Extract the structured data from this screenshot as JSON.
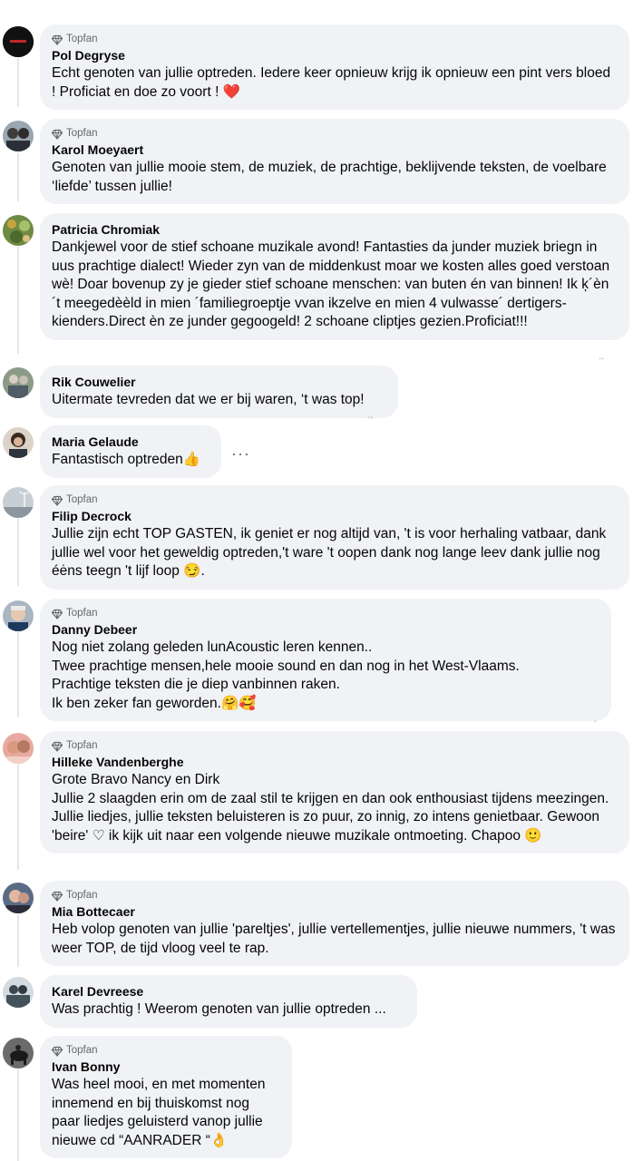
{
  "badge_label": "Topfan",
  "comments": [
    {
      "name": "Pol Degryse",
      "topfan": true,
      "text": "Echt genoten van jullie optreden. Iedere keer opnieuw krijg ik opnieuw een pint vers bloed ! Proficiat en doe zo voort ! ❤️",
      "avatar_color": "#1c1c1c"
    },
    {
      "name": "Karol Moeyaert",
      "topfan": true,
      "text": "Genoten van jullie mooie stem, de muziek, de prachtige, beklijvende teksten, de voelbare ‘liefde’ tussen jullie!",
      "avatar_color": "#6b7684"
    },
    {
      "name": "Patricia Chromiak",
      "topfan": false,
      "text": "Dankjewel voor de stief schoane muzikale avond! Fantasties da junder muziek briegn in uus prachtige dialect! Wieder zyn van de middenkust moar we kosten alles goed verstoan wè! Doar bovenup zy je gieder stief schoane menschen: van buten én van binnen! Ik ķ´èn ´t meegedèèld in mien ´familiegroeptje vvan ikzelve en mien 4 vulwasse´ dertigers- kienders.Direct èn ze junder gegoogeld! 2 schoane cliptjes gezien.Proficiat!!!",
      "avatar_color": "#5d7a3a"
    },
    {
      "name": "Rik Couwelier",
      "topfan": false,
      "text": "Uitermate tevreden dat we er bij waren, ‘t was top!",
      "avatar_color": "#7d8a7a"
    },
    {
      "name": "Maria Gelaude",
      "topfan": false,
      "text": "Fantastisch optreden👍",
      "avatar_color": "#4a3a30",
      "more": "···"
    },
    {
      "name": "Filip Decrock",
      "topfan": true,
      "text": "Jullie zijn echt TOP GASTEN, ik geniet er nog altijd van, 't is voor herhaling vatbaar, dank jullie wel voor het geweldig optreden,'t ware 't oopen dank nog lange leev dank jullie nog éėns teegn 't lijf loop 😏.",
      "avatar_color": "#9aa4ab"
    },
    {
      "name": "Danny Debeer",
      "topfan": true,
      "text": "Nog niet zolang geleden lunAcoustic leren kennen..\nTwee prachtige mensen,hele mooie sound en dan nog in het West-Vlaams.\nPrachtige teksten die je diep vanbinnen raken.\nIk ben zeker fan geworden.🤗🥰",
      "avatar_color": "#8e9aa6"
    },
    {
      "name": "Hilleke Vandenberghe",
      "topfan": true,
      "text": "Grote Bravo Nancy en Dirk\nJullie 2 slaagden erin om de zaal stil te krijgen en dan ook enthousiast tijdens meezingen. Jullie liedjes, jullie teksten beluisteren is zo puur, zo innig, zo intens genietbaar. Gewoon 'beire' ♡ ik kijk uit naar een volgende nieuwe muzikale ontmoeting. Chapoo 🙂",
      "avatar_color": "#c98a7a"
    },
    {
      "name": "Mia Bottecaer",
      "topfan": true,
      "text": "Heb volop genoten van jullie 'pareltjes', jullie vertellementjes, jullie nieuwe nummers, 't was weer TOP, de tijd vloog veel te rap.",
      "avatar_color": "#6a5a58"
    },
    {
      "name": "Karel Devreese",
      "topfan": false,
      "text": "Was prachtig ! Weerom genoten van jullie optreden ...",
      "avatar_color": "#5c6a72"
    },
    {
      "name": "Ivan Bonny",
      "topfan": true,
      "text": "Was heel mooi, en met momenten innemend en bij thuiskomst nog paar liedjes geluisterd vanop jullie nieuwe cd “AANRADER “👌",
      "avatar_color": "#3a3a3a"
    }
  ]
}
